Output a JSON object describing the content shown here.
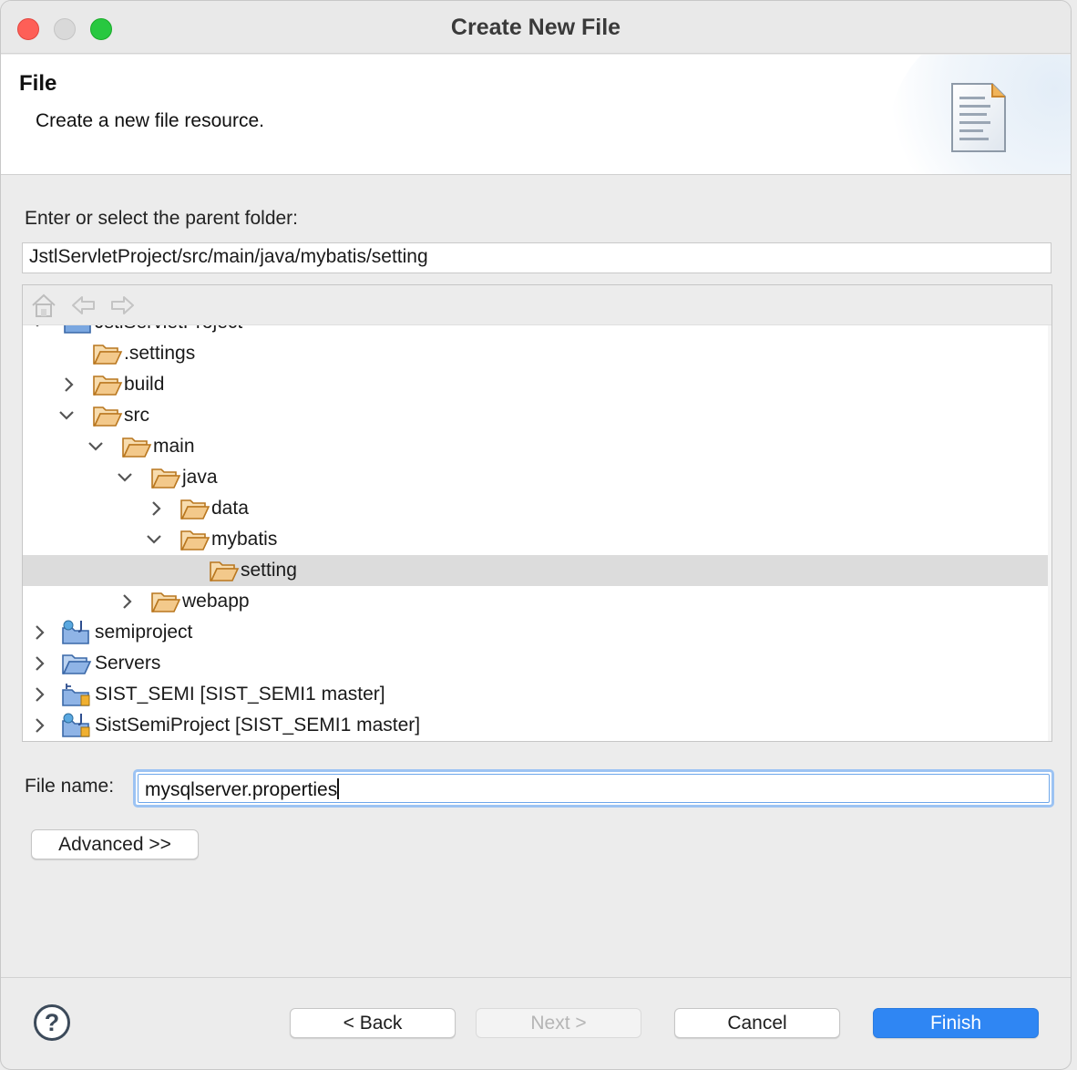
{
  "window": {
    "title": "Create New File"
  },
  "banner": {
    "heading": "File",
    "description": "Create a new file resource."
  },
  "parent_folder": {
    "label": "Enter or select the parent folder:",
    "value": "JstlServletProject/src/main/java/mybatis/setting"
  },
  "tree": {
    "toolbar": {
      "home_icon": "home-icon",
      "back_icon": "back-arrow-icon",
      "forward_icon": "forward-arrow-icon"
    },
    "rows": [
      {
        "label": "JstlServletProject",
        "state": "expanded"
      },
      {
        "label": ".settings",
        "state": "none"
      },
      {
        "label": "build",
        "state": "collapsed"
      },
      {
        "label": "src",
        "state": "expanded"
      },
      {
        "label": "main",
        "state": "expanded"
      },
      {
        "label": "java",
        "state": "expanded"
      },
      {
        "label": "data",
        "state": "collapsed"
      },
      {
        "label": "mybatis",
        "state": "expanded"
      },
      {
        "label": "setting",
        "state": "none",
        "selected": true
      },
      {
        "label": "webapp",
        "state": "collapsed"
      },
      {
        "label": "semiproject",
        "state": "collapsed"
      },
      {
        "label": "Servers",
        "state": "collapsed"
      },
      {
        "label": "SIST_SEMI [SIST_SEMI1 master]",
        "state": "collapsed"
      },
      {
        "label": "SistSemiProject [SIST_SEMI1 master]",
        "state": "collapsed"
      }
    ]
  },
  "file_name": {
    "label": "File name:",
    "value": "mysqlserver.properties"
  },
  "advanced_label": "Advanced >>",
  "footer": {
    "help": "?",
    "back_label": "< Back",
    "next_label": "Next >",
    "cancel_label": "Cancel",
    "finish_label": "Finish"
  },
  "colors": {
    "accent": "#2f86f3",
    "focus_ring": "#9cc3f3",
    "folder_fill": "#f3c98b",
    "folder_stroke": "#b9771f"
  }
}
